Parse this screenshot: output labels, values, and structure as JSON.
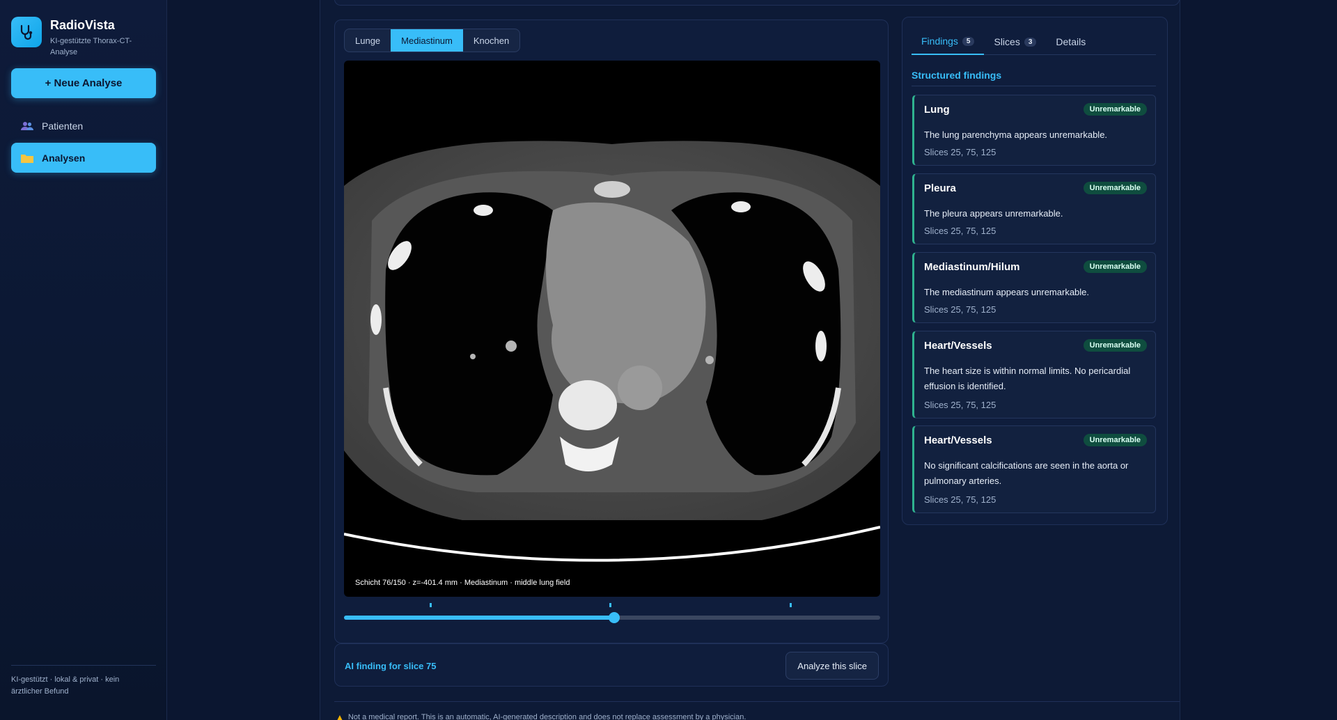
{
  "app": {
    "name": "RadioVista",
    "subtitle": "KI-gestützte Thorax-CT-Analyse",
    "new_button": "+ Neue Analyse",
    "footer": "KI-gestützt · lokal & privat · kein ärztlicher Befund"
  },
  "nav": {
    "items": [
      {
        "label": "Patienten",
        "icon": "people-icon",
        "active": false
      },
      {
        "label": "Analysen",
        "icon": "folder-icon",
        "active": true
      }
    ]
  },
  "viewer": {
    "window_tabs": [
      "Lunge",
      "Mediastinum",
      "Knochen"
    ],
    "active_window": "Mediastinum",
    "caption": "Schicht 76/150 · z=-401.4 mm · Mediastinum · middle lung field",
    "slider": {
      "current": 76,
      "total": 150,
      "marks": [
        25,
        75,
        125
      ]
    }
  },
  "ai": {
    "label": "AI finding for slice 75",
    "button": "Analyze this slice"
  },
  "disclaimer": "Not a medical report. This is an automatic, AI-generated description and does not replace assessment by a physician.",
  "panel": {
    "tabs": [
      {
        "label": "Findings",
        "count": "5",
        "active": true
      },
      {
        "label": "Slices",
        "count": "3",
        "active": false
      },
      {
        "label": "Details",
        "count": "",
        "active": false
      }
    ],
    "section_title": "Structured findings",
    "findings": [
      {
        "title": "Lung",
        "status": "Unremarkable",
        "text": "The lung parenchyma appears unremarkable.",
        "slices": "Slices 25, 75, 125"
      },
      {
        "title": "Pleura",
        "status": "Unremarkable",
        "text": "The pleura appears unremarkable.",
        "slices": "Slices 25, 75, 125"
      },
      {
        "title": "Mediastinum/Hilum",
        "status": "Unremarkable",
        "text": "The mediastinum appears unremarkable.",
        "slices": "Slices 25, 75, 125"
      },
      {
        "title": "Heart/Vessels",
        "status": "Unremarkable",
        "text": "The heart size is within normal limits. No pericardial effusion is identified.",
        "slices": "Slices 25, 75, 125"
      },
      {
        "title": "Heart/Vessels",
        "status": "Unremarkable",
        "text": "No significant calcifications are seen in the aorta or pulmonary arteries.",
        "slices": "Slices 25, 75, 125"
      }
    ]
  },
  "colors": {
    "accent": "#38bdf8",
    "success_badge": "#0f4d3f",
    "finding_border": "#2fb38f"
  }
}
